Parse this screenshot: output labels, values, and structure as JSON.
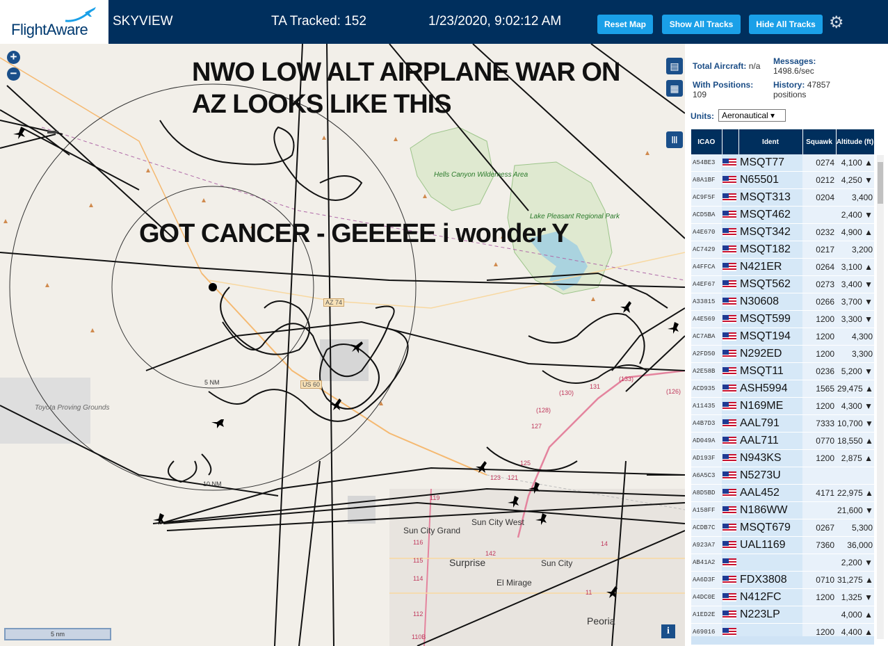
{
  "header": {
    "logo_text": "FlightAware",
    "app_title": "SKYVIEW",
    "tracked": "TA Tracked: 152",
    "datetime": "1/23/2020, 9:02:12 AM",
    "reset_map": "Reset Map",
    "show_all": "Show All Tracks",
    "hide_all": "Hide All Tracks",
    "settings_icon": "gear-icon"
  },
  "map": {
    "overlay_line1": "NWO LOW ALT AIRPLANE WAR ON",
    "overlay_line2": "AZ LOOKS LIKE THIS",
    "overlay_line3": "GOT CANCER - GEEEEE i wonder Y",
    "zoom_in": "+",
    "zoom_out": "−",
    "labels": {
      "hells_canyon": "Hells Canyon Wilderness Area",
      "lake_pleasant": "Lake Pleasant Regional Park",
      "toyota": "Toyota Proving Grounds",
      "sun_city_west": "Sun City West",
      "sun_city_grand": "Sun City Grand",
      "surprise": "Surprise",
      "sun_city": "Sun City",
      "el_mirage": "El Mirage",
      "peoria": "Peoria",
      "ring5": "5 NM",
      "ring10": "10 NM",
      "az74": "AZ 74",
      "us60": "US 60",
      "r131": "131",
      "r130": "(130)",
      "r128": "(128)",
      "r127": "127",
      "r125": "125",
      "r123": "123",
      "r121": "121",
      "r119": "119",
      "r116": "116",
      "r115": "115",
      "r114": "114",
      "r112": "112",
      "r110b": "110B",
      "r142": "142",
      "r14": "14",
      "r11": "11",
      "r126": "(126)",
      "r133": "(133)"
    },
    "scale": "5 nm",
    "info": "i"
  },
  "sidebar": {
    "total_label": "Total Aircraft:",
    "total_value": "n/a",
    "messages_label": "Messages:",
    "messages_value": "1498.6/sec",
    "positions_label": "With Positions:",
    "positions_value": "109",
    "history_label": "History:",
    "history_value": "47857 positions",
    "units_label": "Units:",
    "units_value": "Aeronautical ▾",
    "columns": [
      "ICAO",
      "",
      "Ident",
      "Squawk",
      "Altitude (ft)"
    ],
    "rows": [
      {
        "icao": "A54BE3",
        "ident": "MSQT77",
        "squawk": "0274",
        "alt": "4,100 ▲"
      },
      {
        "icao": "A8A1BF",
        "ident": "N65501",
        "squawk": "0212",
        "alt": "4,250 ▼"
      },
      {
        "icao": "AC9F5F",
        "ident": "MSQT313",
        "squawk": "0204",
        "alt": "3,400"
      },
      {
        "icao": "ACD5BA",
        "ident": "MSQT462",
        "squawk": "",
        "alt": "2,400 ▼"
      },
      {
        "icao": "A4E670",
        "ident": "MSQT342",
        "squawk": "0232",
        "alt": "4,900 ▲"
      },
      {
        "icao": "AC7429",
        "ident": "MSQT182",
        "squawk": "0217",
        "alt": "3,200"
      },
      {
        "icao": "A4FFCA",
        "ident": "N421ER",
        "squawk": "0264",
        "alt": "3,100 ▲"
      },
      {
        "icao": "A4EF67",
        "ident": "MSQT562",
        "squawk": "0273",
        "alt": "3,400 ▼"
      },
      {
        "icao": "A33815",
        "ident": "N30608",
        "squawk": "0266",
        "alt": "3,700 ▼"
      },
      {
        "icao": "A4E569",
        "ident": "MSQT599",
        "squawk": "1200",
        "alt": "3,300 ▼"
      },
      {
        "icao": "AC7ABA",
        "ident": "MSQT194",
        "squawk": "1200",
        "alt": "4,300"
      },
      {
        "icao": "A2FD50",
        "ident": "N292ED",
        "squawk": "1200",
        "alt": "3,300"
      },
      {
        "icao": "A2E58B",
        "ident": "MSQT11",
        "squawk": "0236",
        "alt": "5,200 ▼"
      },
      {
        "icao": "ACD935",
        "ident": "ASH5994",
        "squawk": "1565",
        "alt": "29,475 ▲"
      },
      {
        "icao": "A11435",
        "ident": "N169ME",
        "squawk": "1200",
        "alt": "4,300 ▼"
      },
      {
        "icao": "A4B7D3",
        "ident": "AAL791",
        "squawk": "7333",
        "alt": "10,700 ▼"
      },
      {
        "icao": "AD049A",
        "ident": "AAL711",
        "squawk": "0770",
        "alt": "18,550 ▲"
      },
      {
        "icao": "AD193F",
        "ident": "N943KS",
        "squawk": "1200",
        "alt": "2,875 ▲"
      },
      {
        "icao": "A6A5C3",
        "ident": "N5273U",
        "squawk": "",
        "alt": ""
      },
      {
        "icao": "A8D5BD",
        "ident": "AAL452",
        "squawk": "4171",
        "alt": "22,975 ▲"
      },
      {
        "icao": "A158FF",
        "ident": "N186WW",
        "squawk": "",
        "alt": "21,600 ▼"
      },
      {
        "icao": "ACDB7C",
        "ident": "MSQT679",
        "squawk": "0267",
        "alt": "5,300"
      },
      {
        "icao": "A923A7",
        "ident": "UAL1169",
        "squawk": "7360",
        "alt": "36,000"
      },
      {
        "icao": "AB41A2",
        "ident": "",
        "squawk": "",
        "alt": "2,200 ▼"
      },
      {
        "icao": "AA6D3F",
        "ident": "FDX3808",
        "squawk": "0710",
        "alt": "31,275 ▲"
      },
      {
        "icao": "A4DC0E",
        "ident": "N412FC",
        "squawk": "1200",
        "alt": "1,325 ▼"
      },
      {
        "icao": "A1ED2E",
        "ident": "N223LP",
        "squawk": "",
        "alt": "4,000 ▲"
      },
      {
        "icao": "A69016",
        "ident": "",
        "squawk": "1200",
        "alt": "4,400 ▲"
      }
    ]
  }
}
